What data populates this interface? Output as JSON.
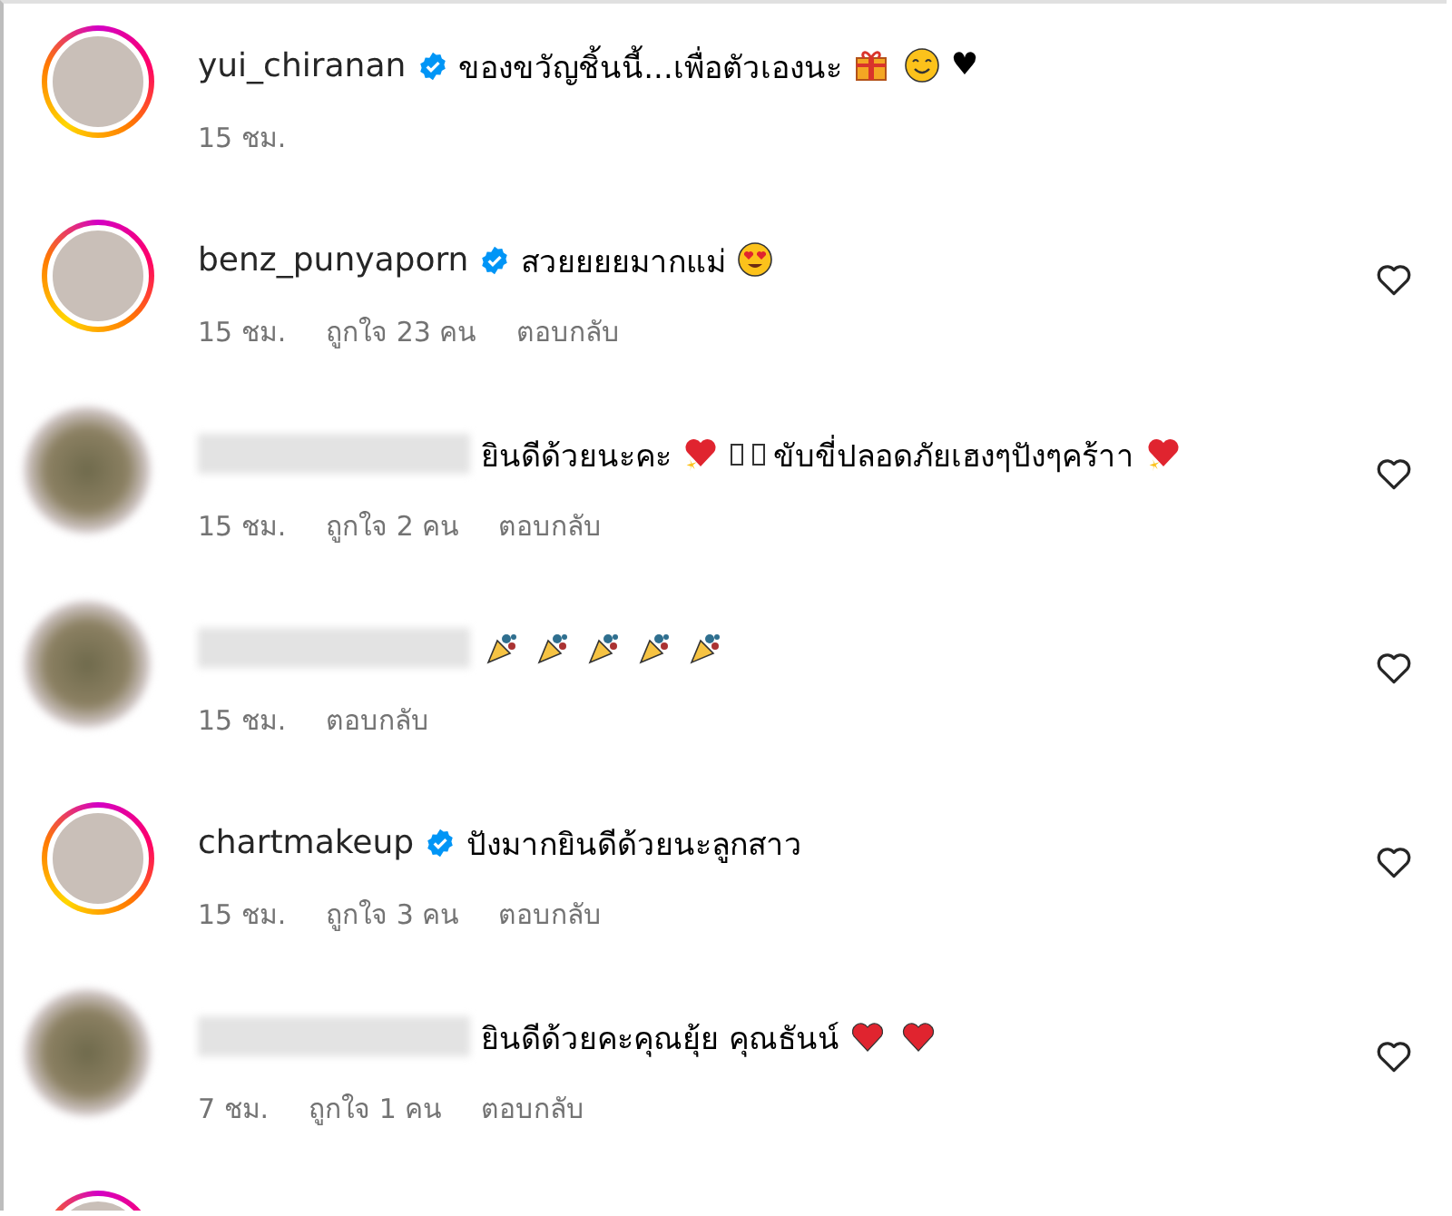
{
  "comments": [
    {
      "hidden_user": false,
      "username": "yui_chiranan",
      "verified": true,
      "story_ring": true,
      "like_button": false,
      "parts": [
        {
          "kind": "text",
          "text": "ของขวัญชิ้นนี้...เพื่อตัวเองนะ"
        },
        {
          "kind": "gift"
        },
        {
          "kind": "smile"
        },
        {
          "kind": "text",
          "text": "♥"
        }
      ],
      "time": "15 ชม."
    },
    {
      "hidden_user": false,
      "username": "benz_punyaporn",
      "verified": true,
      "story_ring": true,
      "like_button": true,
      "parts": [
        {
          "kind": "text",
          "text": "สวยยยยมากแม่"
        },
        {
          "kind": "heart-eyes"
        }
      ],
      "time": "15 ชม.",
      "likes": "ถูกใจ 23 คน",
      "reply": "ตอบกลับ"
    },
    {
      "hidden_user": true,
      "verified": false,
      "story_ring": false,
      "like_button": true,
      "parts": [
        {
          "kind": "text",
          "text": "ยินดีด้วยนะคะ"
        },
        {
          "kind": "sparkling-heart"
        },
        {
          "kind": "missing"
        },
        {
          "kind": "missing"
        },
        {
          "kind": "text",
          "text": "ขับขี่ปลอดภัยเฮงๆปังๆคร้าา"
        },
        {
          "kind": "sparkling-heart"
        }
      ],
      "time": "15 ชม.",
      "likes": "ถูกใจ 2 คน",
      "reply": "ตอบกลับ"
    },
    {
      "hidden_user": true,
      "verified": false,
      "story_ring": false,
      "like_button": true,
      "parts": [
        {
          "kind": "party-popper"
        },
        {
          "kind": "party-popper"
        },
        {
          "kind": "party-popper"
        },
        {
          "kind": "party-popper"
        },
        {
          "kind": "party-popper"
        }
      ],
      "time": "15 ชม.",
      "reply": "ตอบกลับ"
    },
    {
      "hidden_user": false,
      "username": "chartmakeup",
      "verified": true,
      "story_ring": true,
      "like_button": true,
      "parts": [
        {
          "kind": "text",
          "text": "ปังมากยินดีด้วยนะลูกสาว"
        }
      ],
      "time": "15 ชม.",
      "likes": "ถูกใจ 3 คน",
      "reply": "ตอบกลับ"
    },
    {
      "hidden_user": true,
      "verified": false,
      "story_ring": false,
      "like_button": true,
      "parts": [
        {
          "kind": "text",
          "text": "ยินดีด้วยคะคุณยุ้ย คุณธันน์"
        },
        {
          "kind": "red-heart"
        },
        {
          "kind": "red-heart"
        }
      ],
      "time": "7 ชม.",
      "likes": "ถูกใจ 1 คน",
      "reply": "ตอบกลับ"
    }
  ]
}
